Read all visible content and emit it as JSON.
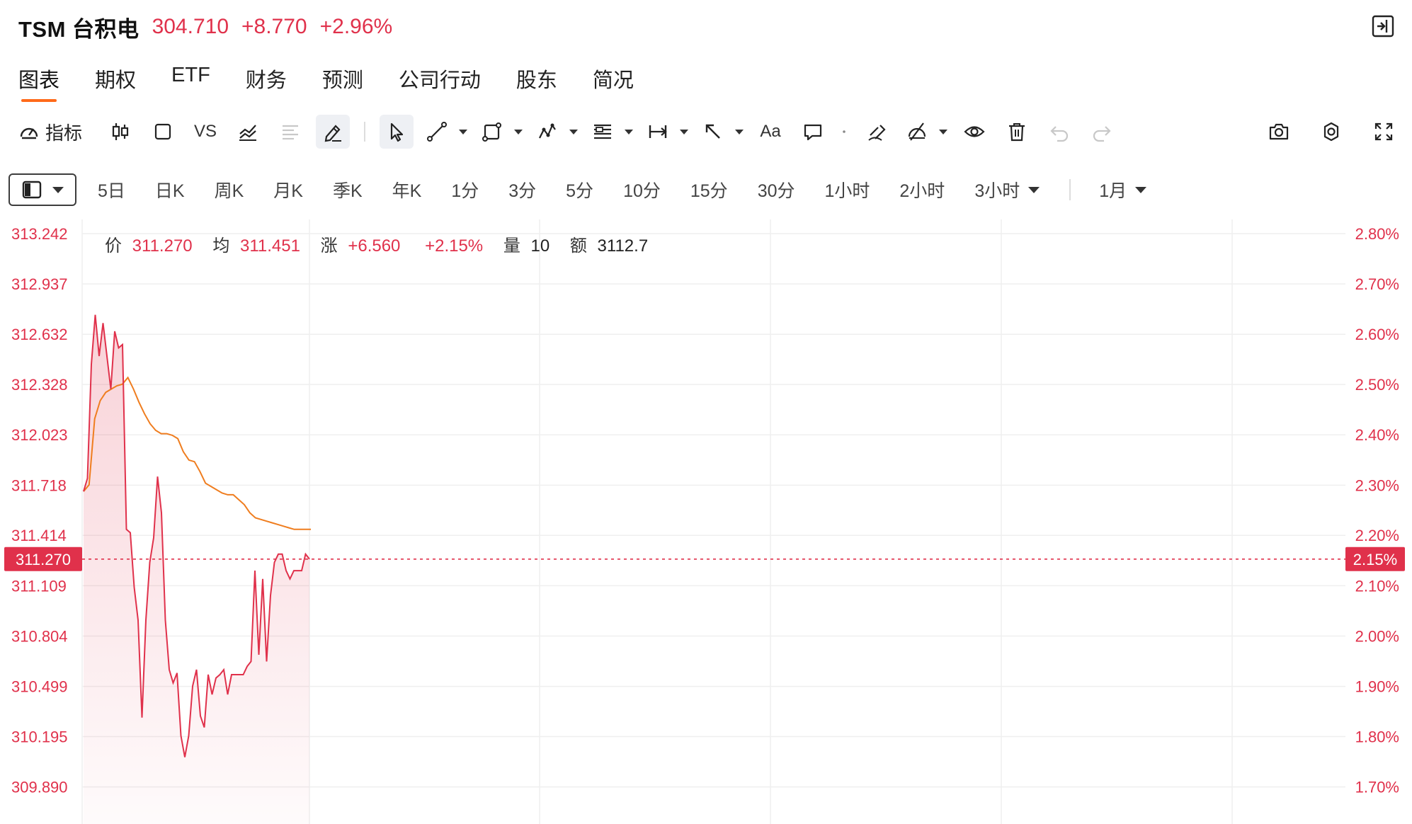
{
  "header": {
    "symbol": "TSM 台积电",
    "price": "304.710",
    "change": "+8.770",
    "change_pct": "+2.96%"
  },
  "tabs": [
    {
      "label": "图表",
      "active": true
    },
    {
      "label": "期权"
    },
    {
      "label": "ETF"
    },
    {
      "label": "财务"
    },
    {
      "label": "预测"
    },
    {
      "label": "公司行动"
    },
    {
      "label": "股东"
    },
    {
      "label": "简况"
    }
  ],
  "toolbar": {
    "indicator_label": "指标",
    "vs_label": "VS",
    "text_tool_label": "Aa",
    "icons_left": [
      "candlestick-icon",
      "rectangle-icon",
      "vs-compare",
      "line-chart-icon",
      "align-icon",
      "pen-icon"
    ],
    "icons_draw": [
      "cursor-icon",
      "trend-line-icon",
      "shape-icon",
      "pattern-icon",
      "fib-icon",
      "measure-icon",
      "arrow-icon",
      "text-icon",
      "comment-icon",
      "dot-icon",
      "magnet-icon",
      "hide-drawings-icon",
      "eye-icon",
      "trash-icon",
      "undo-icon",
      "redo-icon"
    ],
    "icons_right": [
      "camera-icon",
      "gear-icon",
      "fullscreen-icon"
    ]
  },
  "periods": [
    "5日",
    "日K",
    "周K",
    "月K",
    "季K",
    "年K",
    "1分",
    "3分",
    "5分",
    "10分",
    "15分",
    "30分",
    "1小时",
    "2小时",
    "3小时",
    "1月"
  ],
  "info": {
    "price_label": "价",
    "price": "311.270",
    "avg_label": "均",
    "avg": "311.451",
    "chg_label": "涨",
    "chg": "+6.560",
    "pct": "+2.15%",
    "vol_label": "量",
    "vol": "10",
    "amt_label": "额",
    "amt": "3112.7"
  },
  "current": {
    "price": "311.270",
    "pct": "2.15%"
  },
  "colors": {
    "up": "#e0314b",
    "avg_line": "#ef7d1f",
    "grid": "#efefef"
  },
  "chart_data": {
    "type": "line",
    "ylim": [
      309.74,
      313.242
    ],
    "left_ticks": [
      "313.242",
      "312.937",
      "312.632",
      "312.328",
      "312.023",
      "311.718",
      "311.414",
      "311.109",
      "310.804",
      "310.499",
      "310.195",
      "309.890"
    ],
    "right_ticks": [
      "2.80%",
      "2.70%",
      "2.60%",
      "2.50%",
      "2.40%",
      "2.30%",
      "2.20%",
      "2.10%",
      "2.00%",
      "1.90%",
      "1.80%",
      "1.70%"
    ],
    "series": [
      {
        "values": [
          311.68,
          311.76,
          312.45,
          312.75,
          312.5,
          312.7,
          312.5,
          312.3,
          312.65,
          312.55,
          312.57,
          311.45,
          311.43,
          311.1,
          310.9,
          310.31,
          310.9,
          311.25,
          311.4,
          311.77,
          311.55,
          310.9,
          310.6,
          310.52,
          310.58,
          310.2,
          310.07,
          310.2,
          310.5,
          310.6,
          310.32,
          310.25,
          310.57,
          310.45,
          310.55,
          310.57,
          310.6,
          310.45,
          310.57,
          310.57,
          310.57,
          310.57,
          310.62,
          310.65,
          311.2,
          310.69,
          311.15,
          310.65,
          311.05,
          311.25,
          311.3,
          311.3,
          311.2,
          311.15,
          311.2,
          311.2,
          311.2,
          311.3,
          311.27
        ]
      },
      {
        "values": [
          311.68,
          311.72,
          312.12,
          312.23,
          312.28,
          312.3,
          312.32,
          312.33,
          312.37,
          312.3,
          312.22,
          312.15,
          312.09,
          312.05,
          312.03,
          312.03,
          312.02,
          312.0,
          311.92,
          311.87,
          311.86,
          311.8,
          311.73,
          311.71,
          311.69,
          311.67,
          311.66,
          311.66,
          311.63,
          311.6,
          311.55,
          311.52,
          311.51,
          311.5,
          311.49,
          311.48,
          311.47,
          311.46,
          311.45,
          311.45,
          311.45,
          311.45
        ]
      }
    ]
  }
}
